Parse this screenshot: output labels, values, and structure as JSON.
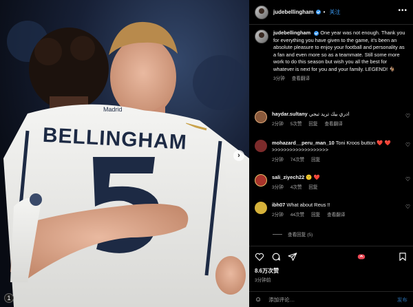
{
  "photo": {
    "jersey_name": "BELLINGHAM",
    "jersey_number": "5",
    "collar_text": "Madrid",
    "carousel_index": "1"
  },
  "post": {
    "author": "judebellingham",
    "follow_label": "关注",
    "dot": "•",
    "more_label": "•••",
    "caption": "One year was not enough. Thank you for everything you have given to the game, it’s been an absolute pleasure to enjoy your football and personality as a fan and even more so as a teammate. Still some more work to do this season but wish you all the best for whatever is next for you and your family. LEGEND! 🐐",
    "caption_age": "3分钟",
    "see_translation": "查看翻译",
    "likes": "8.6万次赞",
    "time_ago": "3分钟前"
  },
  "comments": [
    {
      "user": "haydar.sultany",
      "text": "ادري بيك تريد تبجي",
      "age": "2分钟",
      "likes": "5次赞",
      "reply": "回复",
      "translate": "查看翻译",
      "avatar_color": "#8a5a3c"
    },
    {
      "user": "mohazard__peru_man_10",
      "text": "Toni Kroos button ❤️ ❤️ >>>>>>>>>>>>>>>>>>>",
      "age": "2分钟",
      "likes": "74次赞",
      "reply": "回复",
      "translate": "",
      "avatar_color": "#7c2b2b"
    },
    {
      "user": "sali_ziyech22",
      "text": "🙁 ❤️",
      "age": "3分钟",
      "likes": "4次赞",
      "reply": "回复",
      "translate": "",
      "avatar_color": "#a8342b"
    },
    {
      "user": "ibh07",
      "text": "What about Reus !!",
      "age": "2分钟",
      "likes": "44次赞",
      "reply": "回复",
      "translate": "查看翻译",
      "avatar_color": "#d6b23a"
    }
  ],
  "view_replies": "查看回复 (5)",
  "composer": {
    "placeholder": "添加评论…",
    "post_label": "发布"
  },
  "colors": {
    "accent": "#3897f0",
    "heart_red": "#ed4956",
    "muted": "#a8a8a8"
  }
}
